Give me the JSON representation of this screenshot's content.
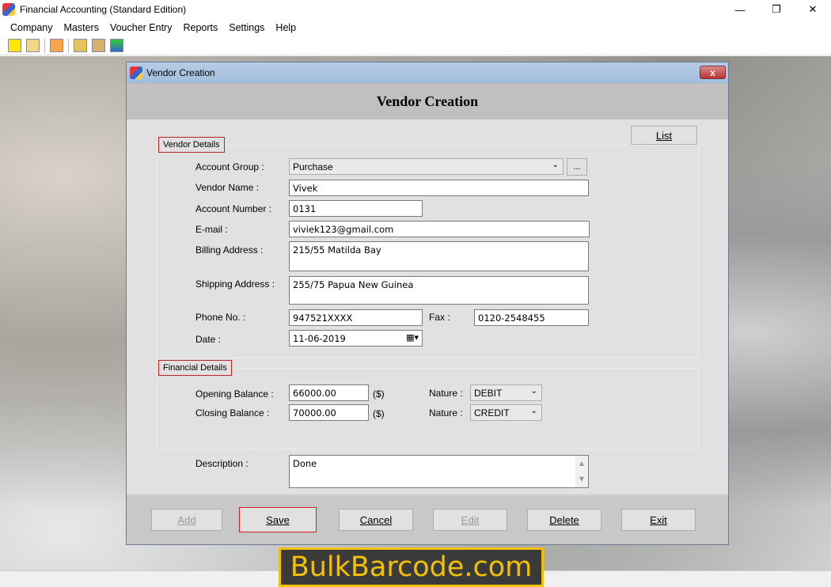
{
  "app": {
    "title": "Financial Accounting (Standard Edition)"
  },
  "window_controls": {
    "minimize": "—",
    "maximize": "❐",
    "close": "✕"
  },
  "menu": [
    "Company",
    "Masters",
    "Voucher Entry",
    "Reports",
    "Settings",
    "Help"
  ],
  "toolbar_icons": [
    "new-icon",
    "open-icon",
    "calculator-icon",
    "balance-icon",
    "diamond-icon",
    "add-entry-icon"
  ],
  "dialog": {
    "title": "Vendor Creation",
    "heading": "Vendor Creation",
    "close": "x",
    "list_button": "List",
    "vendor_details": {
      "legend": "Vendor Details",
      "account_group_label": "Account Group :",
      "account_group": "Purchase",
      "browse": "...",
      "vendor_name_label": "Vendor Name :",
      "vendor_name": "Vivek",
      "account_number_label": "Account Number :",
      "account_number": "0131",
      "email_label": "E-mail :",
      "email": "viviek123@gmail.com",
      "billing_label": "Billing Address :",
      "billing": "215/55 Matilda Bay",
      "shipping_label": "Shipping Address :",
      "shipping": "255/75 Papua New Guinea",
      "phone_label": "Phone No. :",
      "phone": "947521XXXX",
      "fax_label": "Fax :",
      "fax": "0120-2548455",
      "date_label": "Date :",
      "date": "11-06-2019"
    },
    "financial_details": {
      "legend": "Financial Details",
      "opening_label": "Opening Balance :",
      "opening": "66000.00",
      "opening_unit": "($)",
      "closing_label": "Closing Balance :",
      "closing": "70000.00",
      "closing_unit": "($)",
      "nature_label": "Nature :",
      "opening_nature": "DEBIT",
      "closing_nature": "CREDIT"
    },
    "description_label": "Description :",
    "description": "Done",
    "buttons": {
      "add": "Add",
      "save": "Save",
      "cancel": "Cancel",
      "edit": "Edit",
      "delete": "Delete",
      "exit": "Exit"
    }
  },
  "watermark": "BulkBarcode.com"
}
